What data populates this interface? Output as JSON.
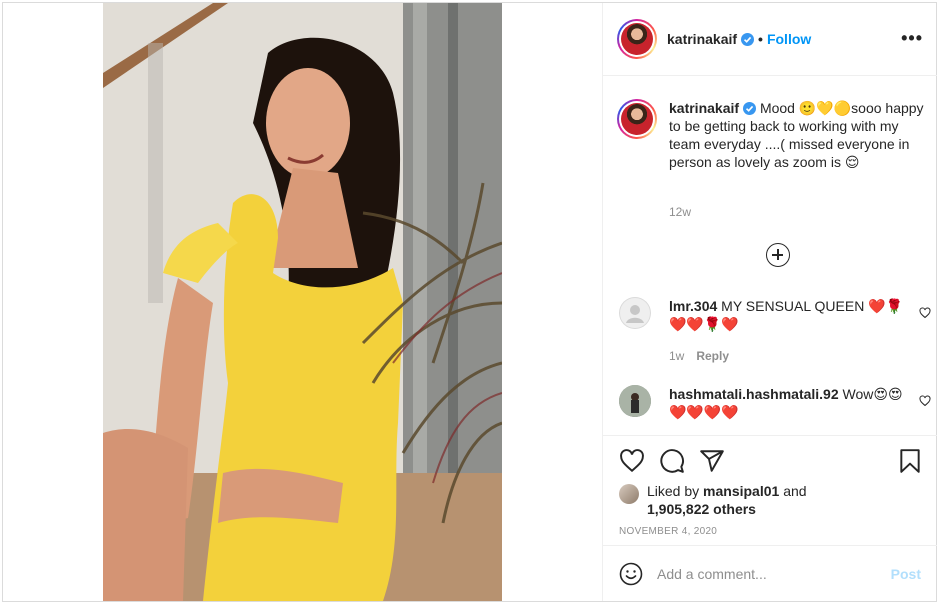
{
  "post": {
    "author": {
      "username": "katrinakaif",
      "verified": true,
      "follow_label": "Follow",
      "avatar": "avatar-icon"
    },
    "caption": {
      "username": "katrinakaif",
      "text_before": "Mood",
      "emojis_inline": "🙂💛🟡",
      "text_after": "sooo happy to be getting back to working with my team everyday ....( missed everyone in person as lovely as zoom is",
      "emoji_end": "😌",
      "time": "12w"
    },
    "comments": [
      {
        "username": "lmr.304",
        "text": "MY SENSUAL QUEEN ❤️🌹❤️❤️🌹❤️",
        "time": "1w",
        "reply_label": "Reply"
      },
      {
        "username": "hashmatali.hashmatali.92",
        "text": "Wow😍😍❤️❤️❤️❤️"
      }
    ],
    "likes": {
      "prefix": "Liked by",
      "user": "mansipal01",
      "conjunction": "and",
      "count": "1,905,822 others"
    },
    "date": "NOVEMBER 4, 2020",
    "add_comment": {
      "placeholder": "Add a comment...",
      "post_label": "Post"
    },
    "colors": {
      "accent": "#0095f6",
      "post_disabled": "#b2dffc",
      "muted": "#8e8e8e",
      "text": "#262626",
      "dress": "#f3d13b"
    },
    "icons": [
      "more-options-icon",
      "verified-badge-icon",
      "load-more-icon",
      "heart-icon",
      "comment-icon",
      "share-icon",
      "save-icon",
      "emoji-icon"
    ]
  }
}
